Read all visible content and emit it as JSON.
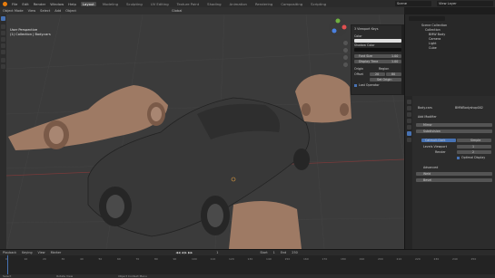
{
  "app": {
    "logo": "blender-logo"
  },
  "menu": [
    "File",
    "Edit",
    "Render",
    "Window",
    "Help"
  ],
  "workspaces": [
    "Layout",
    "Modeling",
    "Sculpting",
    "UV Editing",
    "Texture Paint",
    "Shading",
    "Animation",
    "Rendering",
    "Compositing",
    "Scripting"
  ],
  "active_workspace": "Layout",
  "scene_label": "Scene",
  "view_layer_label": "View Layer",
  "viewport_header": {
    "mode": "Object Mode",
    "menus": [
      "View",
      "Select",
      "Add",
      "Object"
    ],
    "transform": "Global"
  },
  "viewport_info": {
    "line1": "User Perspective",
    "line2": "(1) Collection | Body.cars"
  },
  "npanel": {
    "section": "3 Viewport Keys",
    "color_label": "Color",
    "shadow_label": "Shadow Color",
    "font_size_label": "Font Size",
    "font_size_value": "1.00",
    "display_time_label": "Display Time",
    "display_time_value": "1.00",
    "origin_label": "Origin",
    "region_label": "Region",
    "offset_label": "Offset",
    "offset_x": "20",
    "offset_y": "80",
    "set_origin_label": "Set Origin",
    "last_operator_label": "Last Operator",
    "tabs": [
      "Item",
      "Tool",
      "View",
      "Screencast Keys"
    ]
  },
  "outliner": {
    "rows": [
      "Scene Collection",
      "Collection",
      "BMW Body",
      "Camera",
      "Light",
      "Cube"
    ]
  },
  "properties": {
    "object_name": "Body.cars",
    "modifier_owner": "BMWBodyshop002",
    "add_modifier": "Add Modifier",
    "mirror": "Mirror",
    "subdivision": "Subdivision",
    "catmull_clark": "Catmull-Clark",
    "simple": "Simple",
    "levels_viewport_label": "Levels Viewport",
    "levels_viewport_value": "1",
    "render_label": "Render",
    "render_value": "2",
    "optimal_display": "Optimal Display",
    "advanced": "Advanced",
    "mod3": "Weld",
    "mod4": "Bevel"
  },
  "timeline": {
    "menus": [
      "Playback",
      "Keying",
      "View",
      "Marker"
    ],
    "ticks": [
      "0",
      "10",
      "20",
      "30",
      "40",
      "50",
      "60",
      "70",
      "80",
      "90",
      "100",
      "110",
      "120",
      "130",
      "140",
      "150",
      "160",
      "170",
      "180",
      "190",
      "200",
      "210",
      "220",
      "230",
      "240",
      "250"
    ],
    "current_frame": "1",
    "start_label": "Start",
    "start_value": "1",
    "end_label": "End",
    "end_value": "250"
  },
  "status": {
    "left": "Select",
    "middle": "Rotate View",
    "right": "Object Context Menu"
  },
  "colors": {
    "accent": "#4772b3",
    "car_dark": "#3a3a3a",
    "car_clay": "#9e7a64",
    "grid_bg": "#3b3b3b"
  }
}
